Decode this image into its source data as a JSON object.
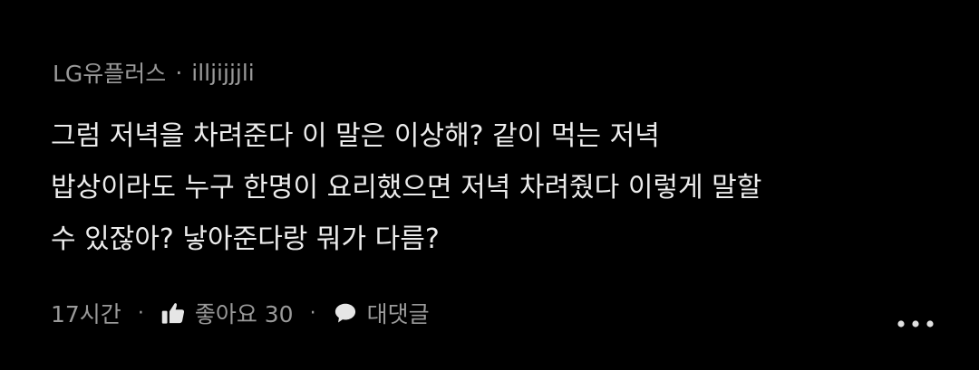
{
  "comment": {
    "author": "LG유플러스",
    "author_separator": "·",
    "handle": "illjijjjli",
    "body_lines": [
      "그럼 저녁을 차려준다 이 말은 이상해? 같이 먹는 저녁",
      "밥상이라도 누구 한명이 요리했으면 저녁 차려줬다 이렇게 말할",
      "수 있잖아? 낳아준다랑 뭐가 다름?"
    ],
    "time": "17시간",
    "separator": "·",
    "like_label": "좋아요 30",
    "reply_label": "대댓글",
    "colors": {
      "background": "#000000",
      "text": "#ececec",
      "muted": "#9a9a9a"
    },
    "icons": {
      "like": "thumbs-up-icon",
      "reply": "speech-bubble-icon",
      "more": "more-horizontal-icon"
    }
  }
}
